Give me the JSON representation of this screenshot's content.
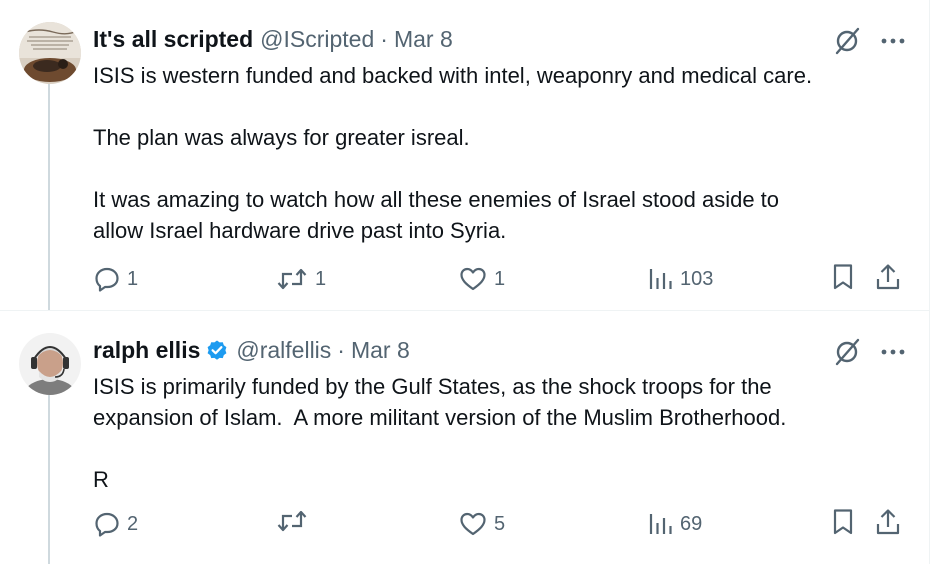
{
  "tweets": [
    {
      "display_name": "It's all scripted",
      "handle": "@IScripted",
      "separator": "·",
      "date": "Mar 8",
      "verified": false,
      "paragraphs": [
        "ISIS is western funded and backed with intel, weaponry and medical care.",
        "The plan was always for greater isreal.",
        "It was amazing to watch how all these enemies of Israel stood aside to\nallow Israel hardware drive past into Syria."
      ],
      "stats": {
        "replies": "1",
        "reposts": "1",
        "likes": "1",
        "views": "103"
      },
      "avatar_icon": "world-stage-quote-avatar"
    },
    {
      "display_name": "ralph ellis",
      "handle": "@ralfellis",
      "separator": "·",
      "date": "Mar 8",
      "verified": true,
      "paragraphs": [
        "ISIS is primarily funded by the Gulf States, as the shock troops for the\nexpansion of Islam.  A more militant version of the Muslim Brotherhood.",
        "R"
      ],
      "stats": {
        "replies": "2",
        "reposts": "",
        "likes": "5",
        "views": "69"
      },
      "avatar_icon": "man-with-headset-avatar"
    }
  ],
  "colors": {
    "text": "#0f1419",
    "secondary": "#536471",
    "verified_blue": "#1d9bf0",
    "thread_line": "#cfd9de"
  },
  "icons": [
    "grok-icon",
    "more-icon",
    "reply-icon",
    "repost-icon",
    "like-icon",
    "views-icon",
    "bookmark-icon",
    "share-icon",
    "verified-badge-icon"
  ]
}
